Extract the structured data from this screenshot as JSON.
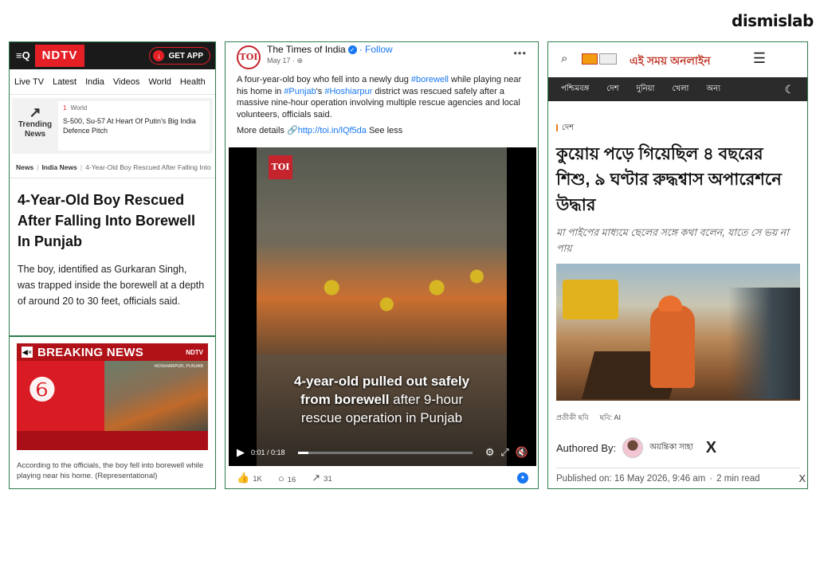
{
  "brand": {
    "logo_text": "dismislab"
  },
  "ndtv": {
    "menu_label": "≡Q",
    "logo": "NDTV",
    "get_app": "GET APP",
    "nav": [
      "Live TV",
      "Latest",
      "India",
      "Videos",
      "World",
      "Health"
    ],
    "trending": {
      "label_line1": "Trending",
      "label_line2": "News",
      "rank": "1",
      "category": "World",
      "title": "S-500, Su-57 At Heart Of Putin's Big India Defence Pitch"
    },
    "breadcrumb": [
      "News",
      "India News",
      "4-Year-Old Boy Rescued After Falling Into"
    ],
    "headline": "4-Year-Old Boy Rescued After Falling Into Borewell In Punjab",
    "body": "The boy, identified as Gurkaran Singh, was trapped inside the borewell at a depth of around 20 to 30 feet, officials said.",
    "breaking_title": "BREAKING NEWS",
    "breaking_logo": "NDTV",
    "breaking_place": "HOSHIARPUR, PUNJAB",
    "caption": "According to the officials, the boy fell into borewell while playing near his home. (Representational)"
  },
  "toi": {
    "avatar_text": "TOI",
    "page_name": "The Times of India",
    "follow": "· Follow",
    "date": "May 17 ·",
    "post_text_1": "A four-year-old boy who fell into a newly dug ",
    "tag_borewell": "#borewell",
    "post_text_2": " while playing near his home in ",
    "tag_punjab": "#Punjab",
    "post_text_3": "'s ",
    "tag_hoshiarpur": "#Hoshiarpur",
    "post_text_4": " district was rescued safely after a massive nine-hour operation involving multiple rescue agencies and local volunteers, officials said.",
    "more_details": "More details ",
    "link": "http://toi.in/lQf5da",
    "see_less": " See less",
    "video_badge": "TOI",
    "overlay_line1_bold": "4-year-old pulled out safely",
    "overlay_line2_bold": "from borewell",
    "overlay_line2_rest": " after 9-hour",
    "overlay_line3": "rescue operation in Punjab",
    "time": "0:01 / 0:18",
    "progress": 0.06,
    "likes": "1K",
    "comments": "16",
    "shares": "31"
  },
  "eisamay": {
    "logo": "এই সময় অনলাইন",
    "nav": [
      "পশ্চিমবঙ্গ",
      "দেশ",
      "দুনিয়া",
      "খেলা",
      "অন্য"
    ],
    "category": "দেশ",
    "headline": "কুয়োয় পড়ে গিয়েছিল ৪ বছরের শিশু, ৯ ঘণ্টার রুদ্ধশ্বাস অপারেশনে উদ্ধার",
    "subheadline": "মা পাইপের মাধ্যমে ছেলের সঙ্গে কথা বলেন, যাতে সে ভয় না পায়",
    "credit_1": "প্রতীকী ছবি",
    "credit_2": "ছবি: AI",
    "authored_by": "Authored By:",
    "author_name": "অয়ন্তিকা সাহা",
    "x_logo": "X",
    "published": "Published on: 16 May 2026, 9:46 am",
    "read_time": "2 min read",
    "close": "X"
  }
}
